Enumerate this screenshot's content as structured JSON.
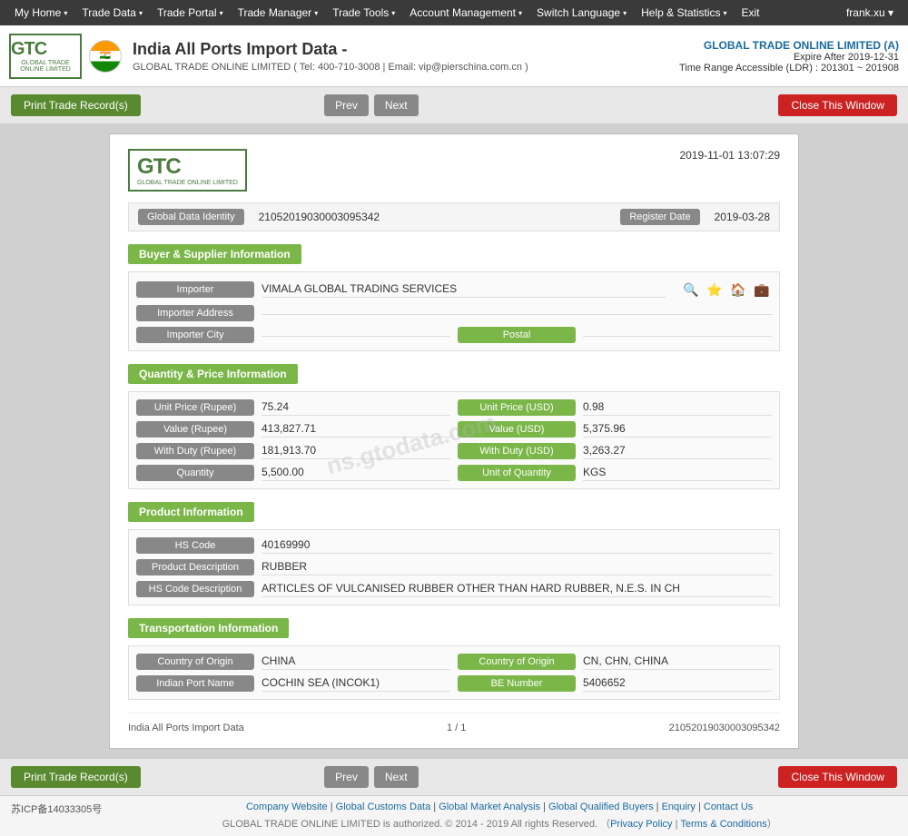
{
  "nav": {
    "items": [
      {
        "label": "My Home",
        "hasArrow": true
      },
      {
        "label": "Trade Data",
        "hasArrow": true
      },
      {
        "label": "Trade Portal",
        "hasArrow": true
      },
      {
        "label": "Trade Manager",
        "hasArrow": true
      },
      {
        "label": "Trade Tools",
        "hasArrow": true
      },
      {
        "label": "Account Management",
        "hasArrow": true
      },
      {
        "label": "Switch Language",
        "hasArrow": true
      },
      {
        "label": "Help & Statistics",
        "hasArrow": true
      },
      {
        "label": "Exit",
        "hasArrow": false
      }
    ],
    "user": "frank.xu ▾"
  },
  "header": {
    "logo_text": "GTC",
    "logo_sub": "GLOBAL TRADE ONLINE LIMITED",
    "title": "India All Ports Import Data",
    "title_dash": " -",
    "contact": "GLOBAL TRADE ONLINE LIMITED ( Tel: 400-710-3008 | Email: vip@pierschina.com.cn )",
    "company": "GLOBAL TRADE ONLINE LIMITED (A)",
    "expire": "Expire After 2019-12-31",
    "time_range": "Time Range Accessible (LDR) : 201301 ~ 201908"
  },
  "toolbar": {
    "print_label": "Print Trade Record(s)",
    "prev_label": "Prev",
    "next_label": "Next",
    "close_label": "Close This Window"
  },
  "record": {
    "logo_text": "GTC",
    "logo_sub": "GLOBAL TRADE ONLINE LIMITED",
    "timestamp": "2019-11-01 13:07:29",
    "global_data_identity_label": "Global Data Identity",
    "global_data_identity_value": "21052019030003095342",
    "register_date_label": "Register Date",
    "register_date_value": "2019-03-28",
    "sections": {
      "buyer_supplier": {
        "header": "Buyer & Supplier Information",
        "importer_label": "Importer",
        "importer_value": "VIMALA GLOBAL TRADING SERVICES",
        "importer_address_label": "Importer Address",
        "importer_address_value": "",
        "importer_city_label": "Importer City",
        "importer_city_value": "",
        "postal_label": "Postal",
        "postal_value": ""
      },
      "quantity_price": {
        "header": "Quantity & Price Information",
        "unit_price_rupee_label": "Unit Price (Rupee)",
        "unit_price_rupee_value": "75.24",
        "unit_price_usd_label": "Unit Price (USD)",
        "unit_price_usd_value": "0.98",
        "value_rupee_label": "Value (Rupee)",
        "value_rupee_value": "413,827.71",
        "value_usd_label": "Value (USD)",
        "value_usd_value": "5,375.96",
        "with_duty_rupee_label": "With Duty (Rupee)",
        "with_duty_rupee_value": "181,913.70",
        "with_duty_usd_label": "With Duty (USD)",
        "with_duty_usd_value": "3,263.27",
        "quantity_label": "Quantity",
        "quantity_value": "5,500.00",
        "unit_of_quantity_label": "Unit of Quantity",
        "unit_of_quantity_value": "KGS"
      },
      "product": {
        "header": "Product Information",
        "hs_code_label": "HS Code",
        "hs_code_value": "40169990",
        "product_description_label": "Product Description",
        "product_description_value": "RUBBER",
        "hs_code_description_label": "HS Code Description",
        "hs_code_description_value": "ARTICLES OF VULCANISED RUBBER OTHER THAN HARD RUBBER, N.E.S. IN CH"
      },
      "transportation": {
        "header": "Transportation Information",
        "country_of_origin_label": "Country of Origin",
        "country_of_origin_value": "CHINA",
        "country_of_origin2_label": "Country of Origin",
        "country_of_origin2_value": "CN, CHN, CHINA",
        "indian_port_label": "Indian Port Name",
        "indian_port_value": "COCHIN SEA (INCOK1)",
        "be_number_label": "BE Number",
        "be_number_value": "5406652"
      }
    },
    "footer_source": "India All Ports Import Data",
    "footer_page": "1 / 1",
    "footer_id": "21052019030003095342",
    "watermark": "ns.gtodata.com"
  },
  "footer": {
    "icp": "苏ICP备14033305号",
    "links": [
      "Company Website",
      "Global Customs Data",
      "Global Market Analysis",
      "Global Qualified Buyers",
      "Enquiry",
      "Contact Us"
    ],
    "copyright": "GLOBAL TRADE ONLINE LIMITED is authorized. © 2014 - 2019 All rights Reserved.",
    "privacy": "Privacy Policy",
    "terms": "Terms & Conditions"
  }
}
